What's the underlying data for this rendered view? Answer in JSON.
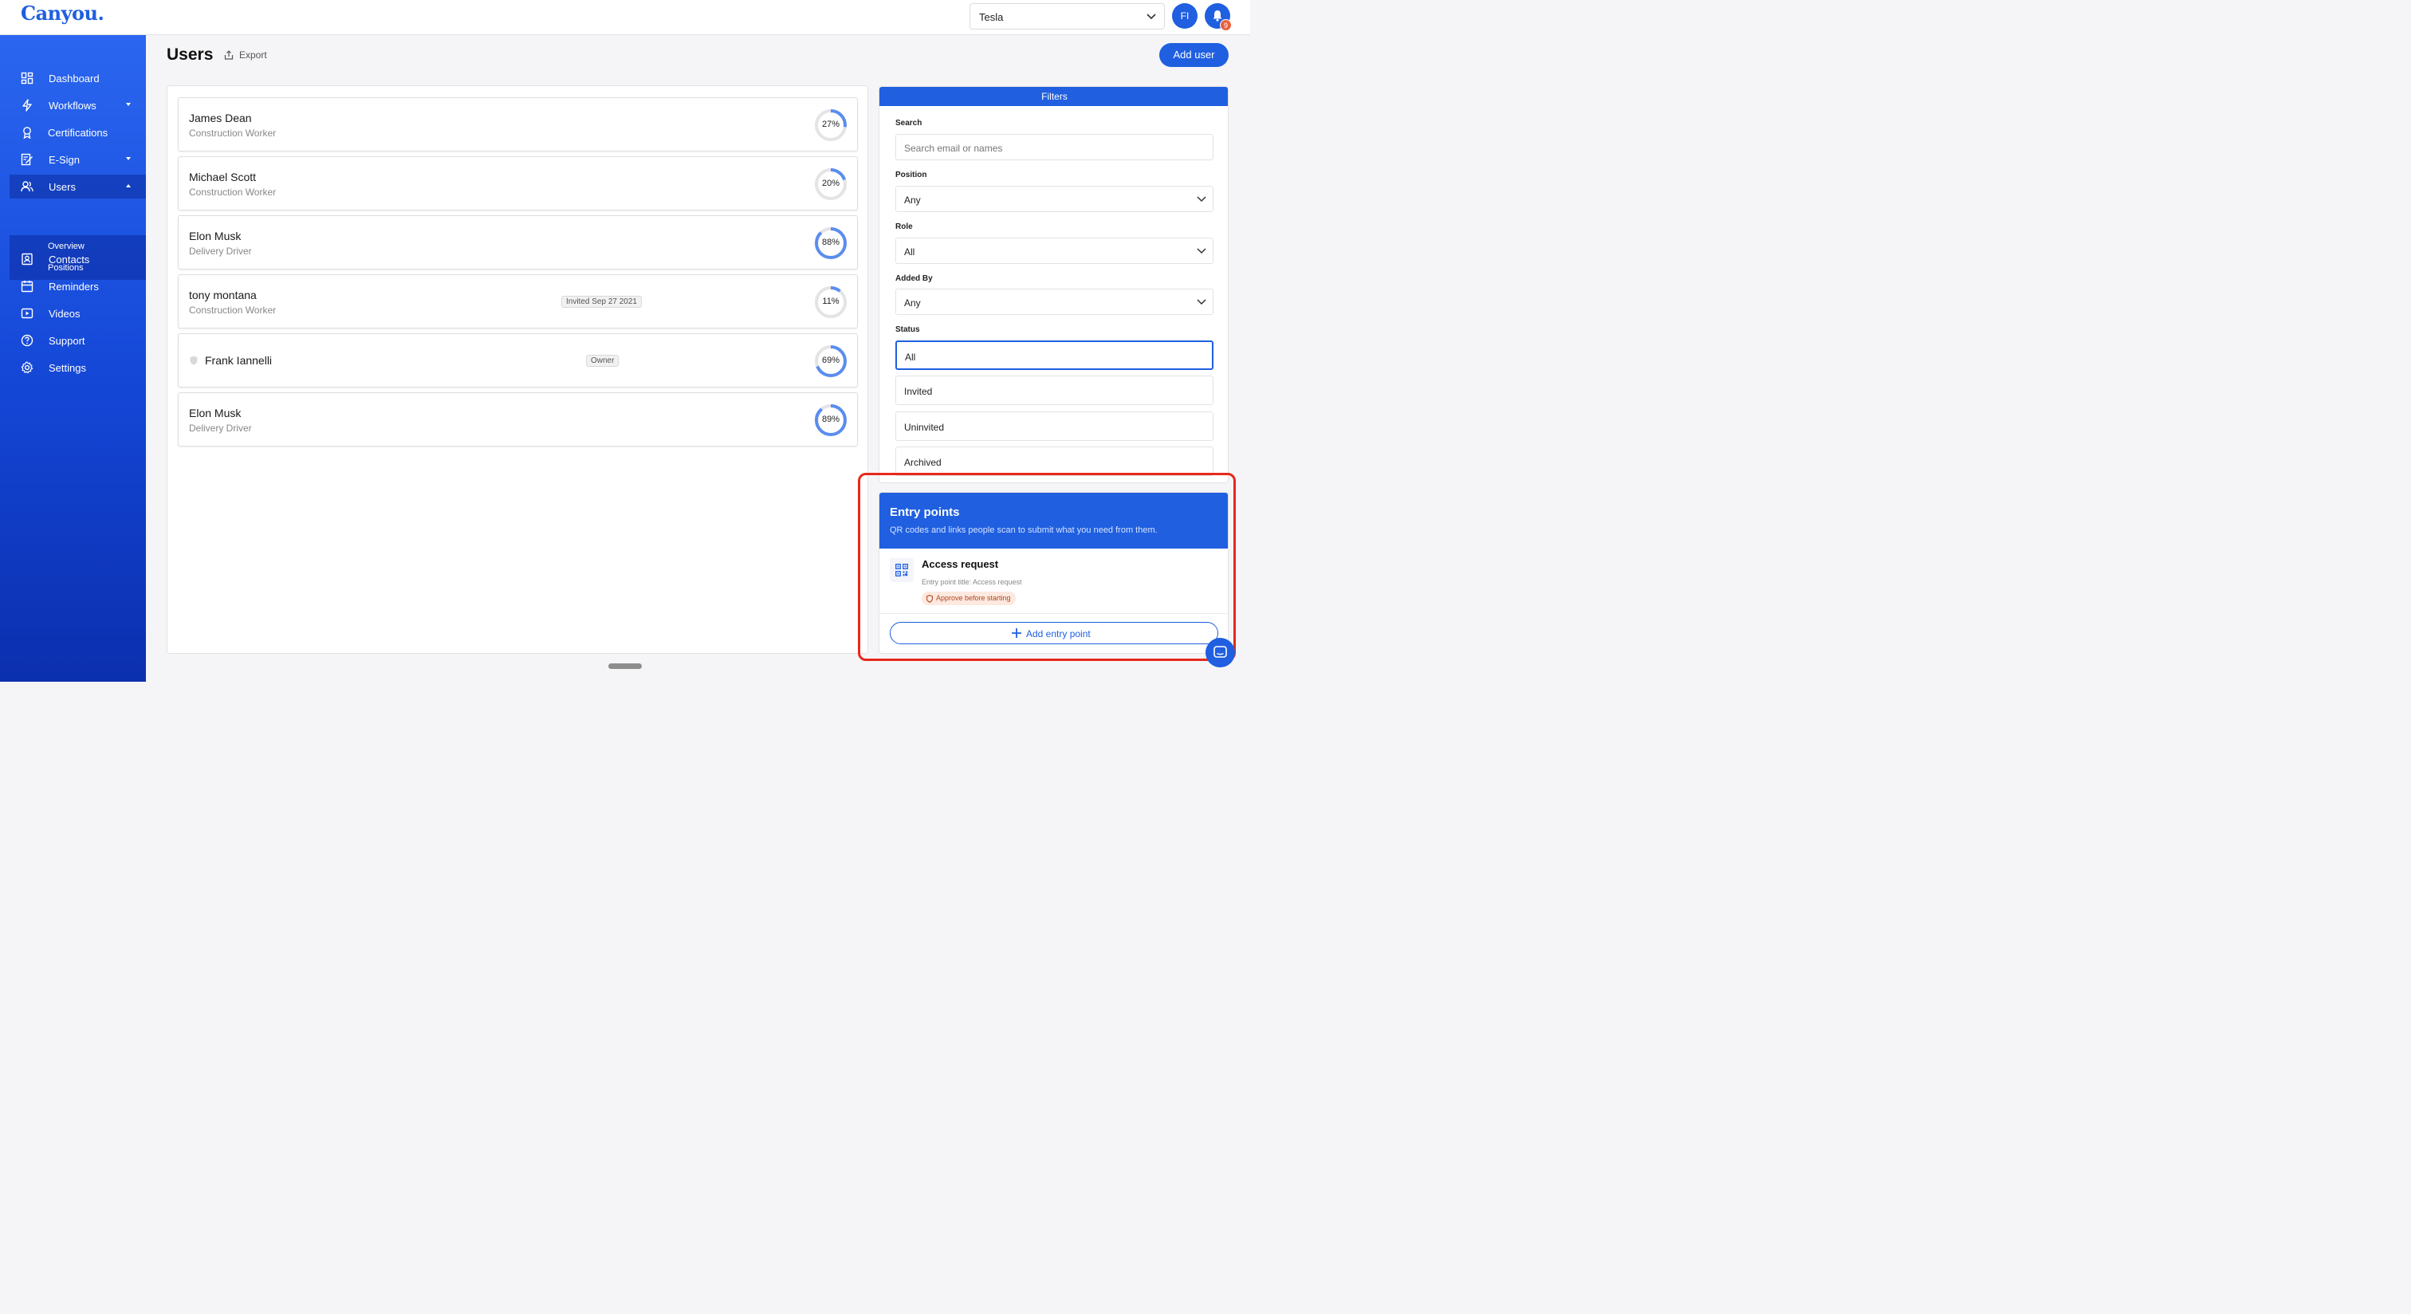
{
  "app": {
    "logo": "Canyou."
  },
  "topbar": {
    "org_select_value": "Tesla",
    "avatar_initials": "FI",
    "notification_count": "9"
  },
  "sidebar": {
    "items": [
      {
        "label": "Dashboard",
        "icon": "dashboard-icon"
      },
      {
        "label": "Workflows",
        "icon": "lightning-icon",
        "has_dropdown": true
      },
      {
        "label": "Certifications",
        "icon": "award-icon"
      },
      {
        "label": "E-Sign",
        "icon": "signature-icon",
        "has_dropdown": true
      },
      {
        "label": "Users",
        "icon": "users-icon",
        "expanded": true,
        "active": true
      },
      {
        "label": "Contacts",
        "icon": "contact-icon"
      },
      {
        "label": "Reminders",
        "icon": "calendar-icon"
      },
      {
        "label": "Videos",
        "icon": "video-icon"
      },
      {
        "label": "Support",
        "icon": "help-icon"
      },
      {
        "label": "Settings",
        "icon": "gear-icon"
      }
    ],
    "users_subitems": [
      "Overview",
      "Positions"
    ]
  },
  "header": {
    "title": "Users",
    "export_label": "Export",
    "add_user_label": "Add user"
  },
  "users": [
    {
      "name": "James Dean",
      "position": "Construction Worker",
      "progress": 27,
      "progress_label": "27%",
      "pill": ""
    },
    {
      "name": "Michael Scott",
      "position": "Construction Worker",
      "progress": 20,
      "progress_label": "20%",
      "pill": ""
    },
    {
      "name": "Elon Musk",
      "position": "Delivery Driver",
      "progress": 88,
      "progress_label": "88%",
      "pill": ""
    },
    {
      "name": "tony montana",
      "position": "Construction Worker",
      "progress": 11,
      "progress_label": "11%",
      "pill": "Invited Sep 27 2021"
    },
    {
      "name": "Frank Iannelli",
      "position": "",
      "progress": 69,
      "progress_label": "69%",
      "pill": "Owner"
    },
    {
      "name": "Elon Musk",
      "position": "Delivery Driver",
      "progress": 89,
      "progress_label": "89%",
      "pill": ""
    }
  ],
  "filters": {
    "title": "Filters",
    "search_label": "Search",
    "search_placeholder": "Search email or names",
    "position_label": "Position",
    "position_value": "Any",
    "role_label": "Role",
    "role_value": "All",
    "added_by_label": "Added By",
    "added_by_value": "Any",
    "status_label": "Status",
    "status_options": [
      "All",
      "Invited",
      "Uninvited",
      "Archived"
    ],
    "status_selected": "All"
  },
  "entry_points": {
    "title": "Entry points",
    "subtitle": "QR codes and links people scan to submit what you need from them.",
    "items": [
      {
        "title": "Access request",
        "subtitle": "Entry point title: Access request",
        "badge": "Approve before starting"
      }
    ],
    "add_label": "Add entry point"
  },
  "colors": {
    "brand": "#1f5fe0",
    "highlight": "#e8281b",
    "ring_track": "#e4e4e4",
    "ring_fill": "#5b8def"
  }
}
